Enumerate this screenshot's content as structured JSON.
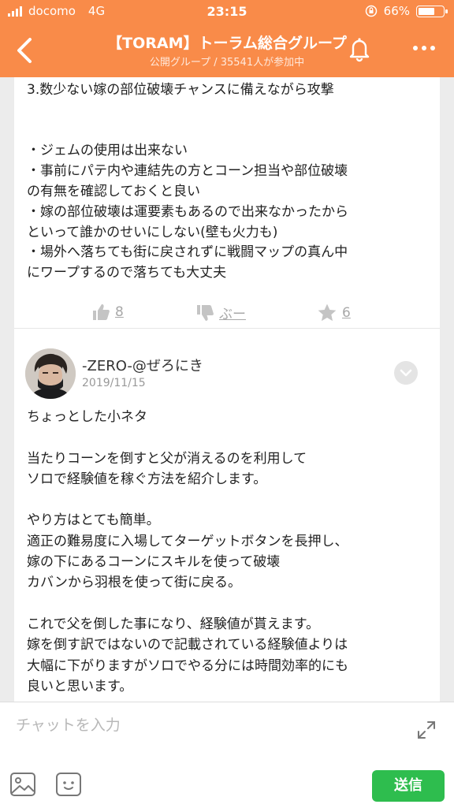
{
  "status_bar": {
    "carrier": "docomo",
    "network": "4G",
    "time": "23:15",
    "battery": "66%"
  },
  "header": {
    "title": "【TORAM】トーラム総合グループ",
    "subtitle": "公開グループ / 35541人が参加中",
    "accent_color": "#f98b49"
  },
  "post1": {
    "text": "3.数少ない嫁の部位破壊チャンスに備えながら攻撃\n\n\n・ジェムの使用は出来ない\n・事前にパテ内や連結先の方とコーン担当や部位破壊\nの有無を確認しておくと良い\n・嫁の部位破壊は運要素もあるので出来なかったから\nといって誰かのせいにしない(壁も火力も)\n・場外へ落ちても街に戻されずに戦闘マップの真ん中\nにワープするので落ちても大丈夫",
    "like_count": "8",
    "boo_label": "ぶー",
    "fav_count": "6"
  },
  "post2": {
    "author": "-ZERO-@ぜろにき",
    "date": "2019/11/15",
    "text": "ちょっとした小ネタ\n\n当たりコーンを倒すと父が消えるのを利用して\nソロで経験値を稼ぐ方法を紹介します。\n\nやり方はとても簡単。\n適正の難易度に入場してターゲットボタンを長押し、\n嫁の下にあるコーンにスキルを使って破壊\nカバンから羽根を使って街に戻る。\n\nこれで父を倒した事になり、経験値が貰えます。\n嫁を倒す訳ではないので記載されている経験値よりは\n大幅に下がりますがソロでやる分には時間効率的にも\n良いと思います。"
  },
  "input_bar": {
    "placeholder": "チャットを入力",
    "send_label": "送信",
    "send_color": "#2ebd4e"
  }
}
